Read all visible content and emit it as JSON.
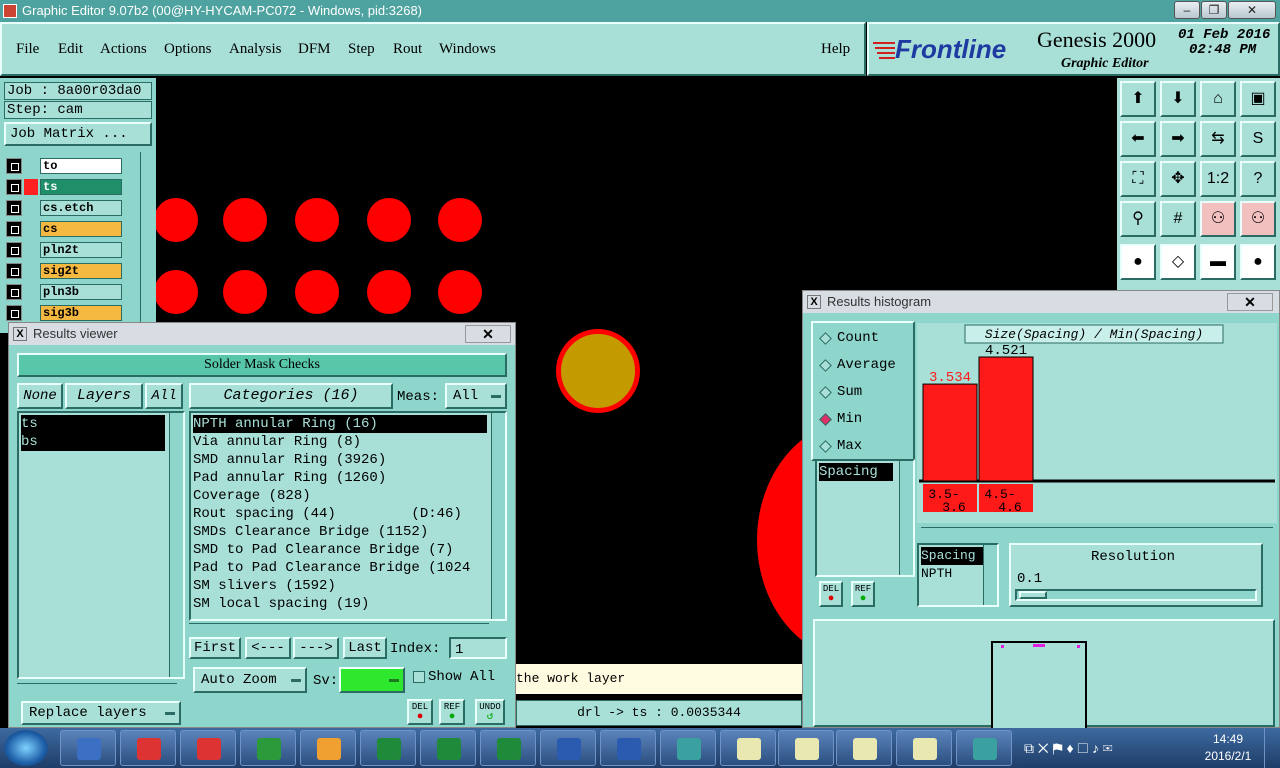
{
  "window": {
    "title": "Graphic Editor 9.07b2 (00@HY-HYCAM-PC072 - Windows, pid:3268)"
  },
  "menu": {
    "items": [
      "File",
      "Edit",
      "Actions",
      "Options",
      "Analysis",
      "DFM",
      "Step",
      "Rout",
      "Windows"
    ],
    "help": "Help"
  },
  "brand": {
    "logo": "Frontline",
    "product": "Genesis 2000",
    "subtitle": "Graphic Editor",
    "date": "01 Feb 2016",
    "time": "02:48 PM"
  },
  "job": {
    "job_label": "Job : 8a00r03da0",
    "step_label": "Step: cam",
    "matrix_button": "Job Matrix ..."
  },
  "layers": [
    {
      "name": "to",
      "color": "#ffffff"
    },
    {
      "name": "ts",
      "color": "#1f8f6a"
    },
    {
      "name": "cs.etch",
      "color": "#a8e0d8"
    },
    {
      "name": "cs",
      "color": "#f5b942"
    },
    {
      "name": "pln2t",
      "color": "#a8e0d8"
    },
    {
      "name": "sig2t",
      "color": "#f5b942"
    },
    {
      "name": "pln3b",
      "color": "#a8e0d8"
    },
    {
      "name": "sig3b",
      "color": "#f5b942"
    }
  ],
  "results_viewer": {
    "title": "Results viewer",
    "close": "✕",
    "header": "Solder Mask Checks",
    "none_btn": "None",
    "layers_btn": "Layers",
    "all_btn": "All",
    "categories_btn": "Categories (16)",
    "meas_label": "Meas:",
    "meas_value": "All",
    "layer_list": [
      "ts",
      "bs"
    ],
    "categories": [
      "NPTH annular Ring (16)",
      "Via annular Ring (8)",
      "SMD annular Ring (3926)",
      "Pad annular Ring (1260)",
      "Coverage (828)",
      "Rout spacing (44)         (D:46)",
      "SMDs Clearance Bridge (1152)",
      "SMD to Pad Clearance Bridge (7)",
      "Pad to Pad Clearance Bridge (1024",
      "SM slivers (1592)",
      "SM local spacing (19)"
    ],
    "first_btn": "First",
    "prev_btn": "<---",
    "next_btn": "--->",
    "last_btn": "Last",
    "index_label": "Index:",
    "index_value": "1",
    "auto_zoom": "Auto Zoom",
    "sv_label": "Sv:",
    "show_all": "Show All",
    "replace_layers": "Replace layers",
    "del_btn": "DEL",
    "ref_btn": "REF",
    "undo_btn": "UNDO"
  },
  "status": {
    "message": "the work layer",
    "measure": "drl -> ts : 0.0035344"
  },
  "histogram": {
    "title": "Results histogram",
    "close": "✕",
    "modes": [
      "Count",
      "Average",
      "Sum",
      "Min",
      "Max"
    ],
    "selected_mode": "Min",
    "list_item": "Spacing",
    "del_btn": "DEL",
    "ref_btn": "REF",
    "sub_list": [
      "Spacing",
      "NPTH"
    ],
    "resolution_label": "Resolution",
    "resolution_value": "0.1"
  },
  "chart_data": {
    "type": "bar",
    "title": "Size(Spacing) / Min(Spacing)",
    "categories": [
      "3.5-3.6",
      "4.5-4.6"
    ],
    "values": [
      3.534,
      4.521
    ],
    "value_labels": [
      "3.534",
      "4.521"
    ],
    "bar_color": "#ff1a1a"
  },
  "taskbar": {
    "time": "14:49",
    "date": "2016/2/1"
  }
}
